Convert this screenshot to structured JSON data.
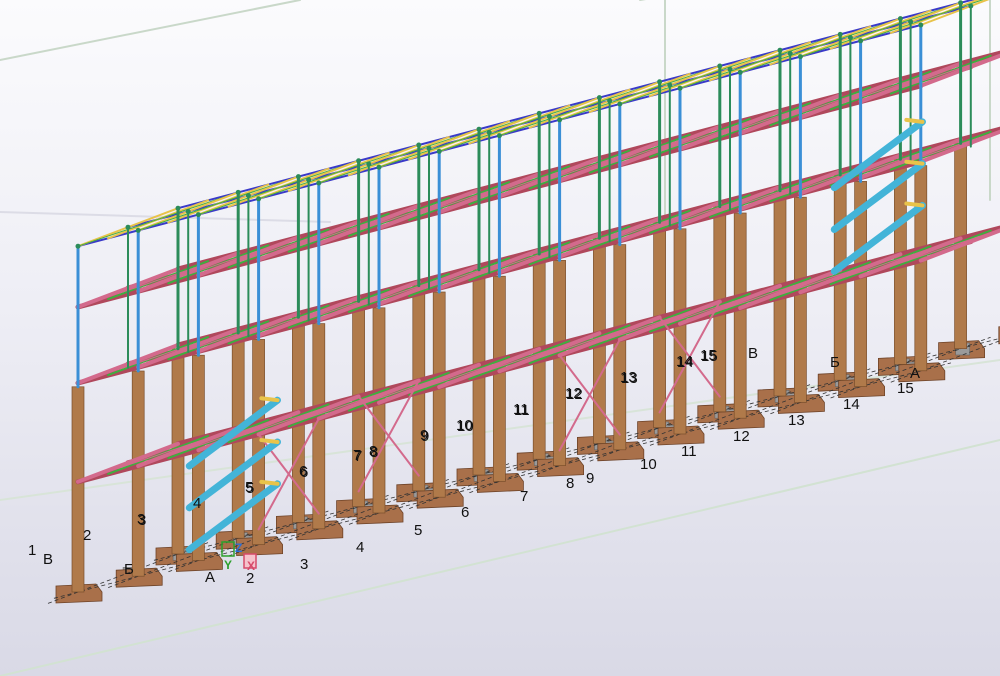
{
  "model_view": {
    "colors": {
      "background_top": "#fbfbfd",
      "background_bottom": "#d9d9e6",
      "column_concrete": "#b07a4a",
      "footing": "#a9704a",
      "beam_red": "#b0485c",
      "beam_pink": "#d36a8c",
      "column_steel": "#2c8c5a",
      "brace_green": "#3fae3f",
      "purlin_yellow": "#e8c34a",
      "truss_blue": "#3a3ac8",
      "column_cyan": "#3a8fd6",
      "stair_cyan": "#43b4d8",
      "pedestal_gray": "#9a9a9a",
      "grid_dashed": "#333333"
    },
    "grid_labels": {
      "front_numbers": [
        "1",
        "2",
        "3",
        "4",
        "5",
        "6",
        "7",
        "8",
        "9",
        "10",
        "11",
        "12",
        "13",
        "14",
        "15"
      ],
      "mid_numbers": [
        "2",
        "3",
        "4",
        "5",
        "6",
        "7",
        "8",
        "9",
        "10",
        "11",
        "12",
        "13",
        "14",
        "15"
      ],
      "back_numbers": [
        "3",
        "5",
        "6",
        "7",
        "8",
        "9",
        "10",
        "11",
        "12",
        "13",
        "14",
        "15"
      ],
      "letters": [
        "В",
        "Б",
        "А",
        "Б",
        "А",
        "В"
      ]
    },
    "axes_gizmo": {
      "x": "X",
      "y": "Y",
      "z": "Z"
    }
  }
}
